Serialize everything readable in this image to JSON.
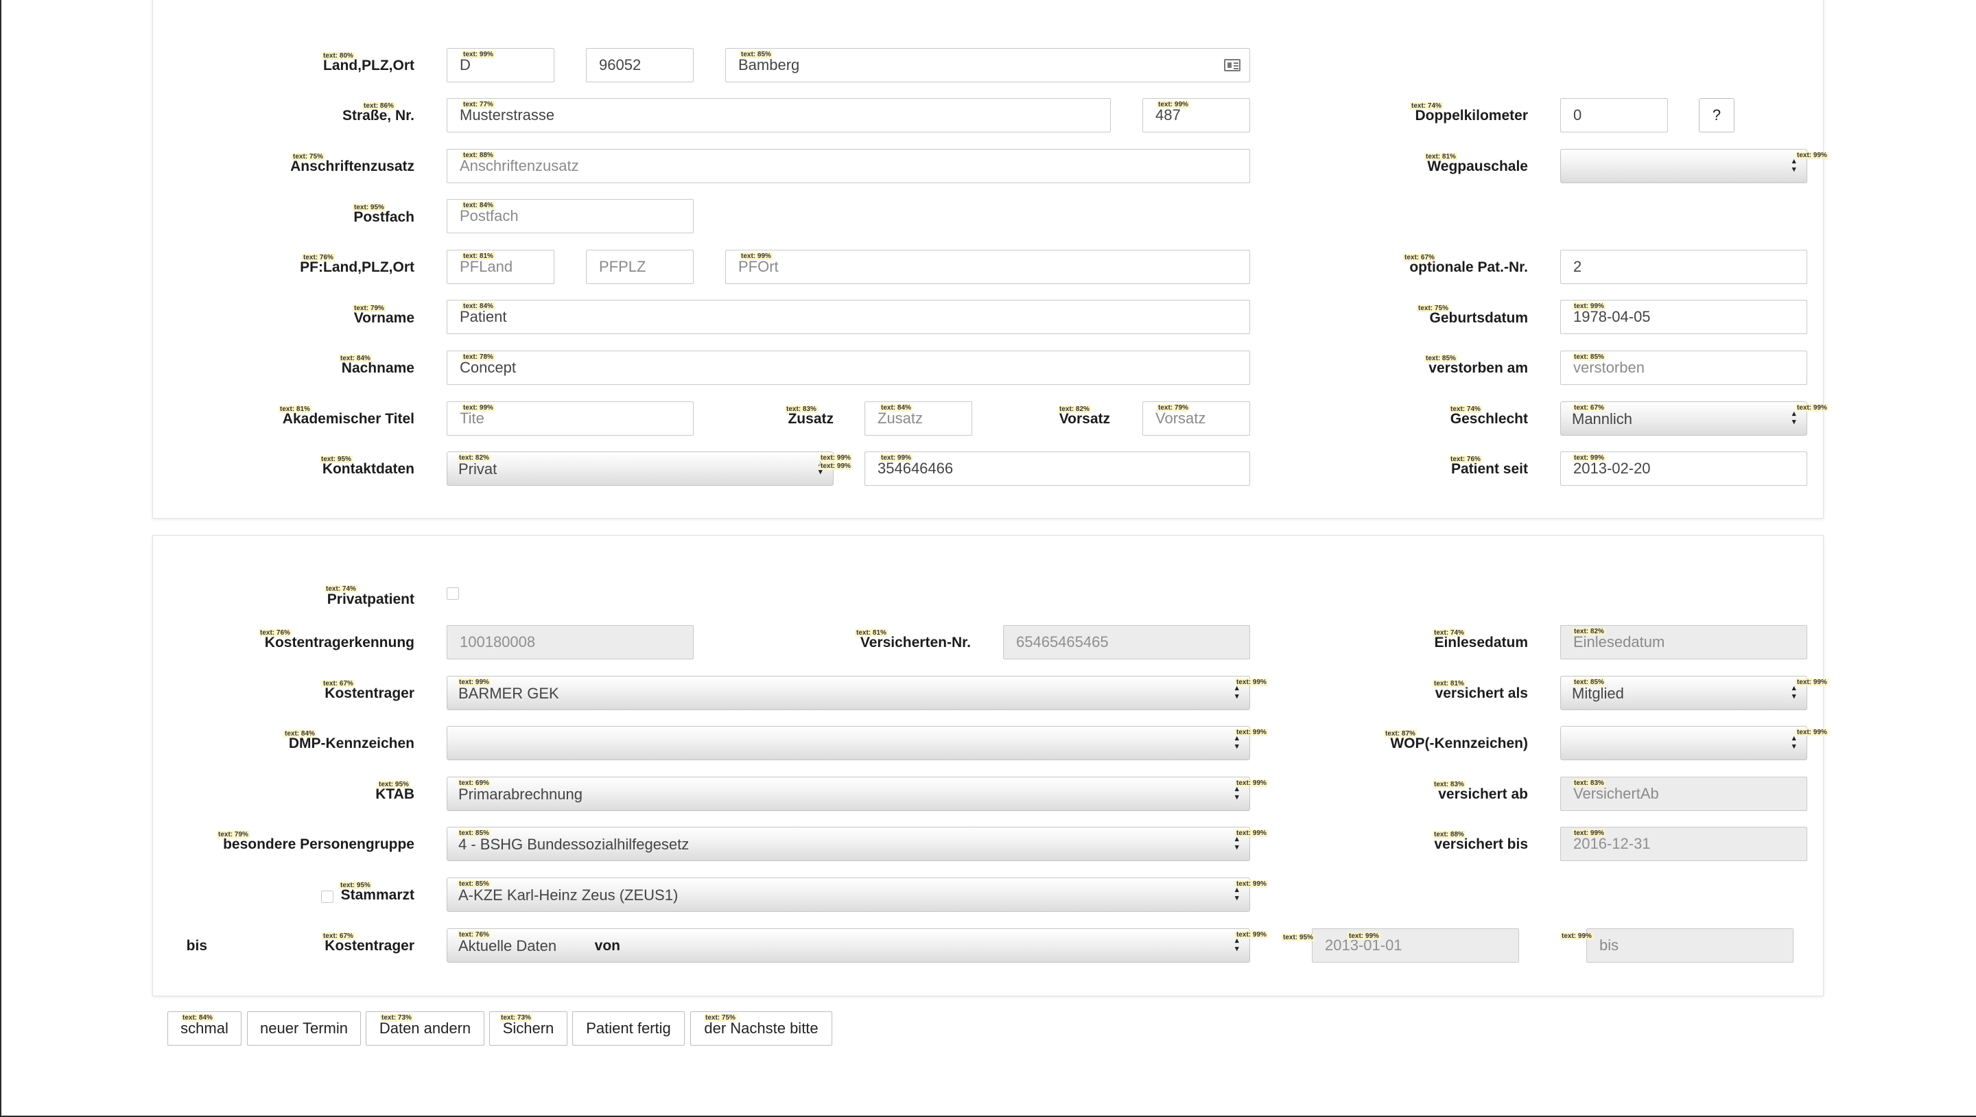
{
  "address": {
    "land_plz_ort_label": "Land,PLZ,Ort",
    "land_value": "D",
    "plz_value": "96052",
    "ort_value": "Bamberg",
    "strasse_label": "Straße, Nr.",
    "strasse_value": "Musterstrasse",
    "hausnr_value": "487",
    "anschriftzusatz_label": "Anschriftenzusatz",
    "anschriftzusatz_placeholder": "Anschriftenzusatz",
    "postfach_label": "Postfach",
    "postfach_placeholder": "Postfach",
    "pf_land_plz_ort_label": "PF:Land,PLZ,Ort",
    "pf_land_placeholder": "PFLand",
    "pf_plz_placeholder": "PFPLZ",
    "pf_ort_placeholder": "PFOrt"
  },
  "person": {
    "vorname_label": "Vorname",
    "vorname_value": "Patient",
    "nachname_label": "Nachname",
    "nachname_value": "Concept",
    "titel_label": "Akademischer Titel",
    "titel_placeholder": "Tite",
    "zusatz_label": "Zusatz",
    "zusatz_placeholder": "Zusatz",
    "vorsatz_label": "Vorsatz",
    "vorsatz_placeholder": "Vorsatz",
    "kontaktdaten_label": "Kontaktdaten",
    "kontaktdaten_type": "Privat",
    "kontaktdaten_value": "354646466"
  },
  "right": {
    "doppelkilometer_label": "Doppelkilometer",
    "doppelkilometer_value": "0",
    "help_label": "?",
    "wegpauschale_label": "Wegpauschale",
    "wegpauschale_value": "",
    "opt_patnr_label": "optionale Pat.-Nr.",
    "opt_patnr_value": "2",
    "geburtsdatum_label": "Geburtsdatum",
    "geburtsdatum_value": "1978-04-05",
    "verstorben_label": "verstorben am",
    "verstorben_placeholder": "verstorben",
    "geschlecht_label": "Geschlecht",
    "geschlecht_value": "Mannlich",
    "patient_seit_label": "Patient seit",
    "patient_seit_value": "2013-02-20"
  },
  "insurance": {
    "privatpatient_label": "Privatpatient",
    "kostentraegerkennung_label": "Kostentragerkennung",
    "kostentraegerkennung_value": "100180008",
    "versichertennr_label": "Versicherten-Nr.",
    "versichertennr_value": "65465465465",
    "einlesedatum_label": "Einlesedatum",
    "einlesedatum_placeholder": "Einlesedatum",
    "kostentraeger_label": "Kostentrager",
    "kostentraeger_value": "BARMER GEK",
    "versichert_als_label": "versichert als",
    "versichert_als_value": "Mitglied",
    "dmp_label": "DMP-Kennzeichen",
    "dmp_value": "",
    "wop_label": "WOP(-Kennzeichen)",
    "wop_value": "",
    "ktab_label": "KTAB",
    "ktab_value": "Primarabrechnung",
    "versichert_ab_label": "versichert ab",
    "versichert_ab_placeholder": "VersichertAb",
    "besondere_label": "besondere Personengruppe",
    "besondere_value": "4 - BSHG Bundessozialhilfegesetz",
    "versichert_bis_label": "versichert bis",
    "versichert_bis_value": "2016-12-31",
    "stammarzt_label": "Stammarzt",
    "stammarzt_value": "A-KZE Karl-Heinz Zeus (ZEUS1)",
    "kostentraeger2_label": "Kostentrager",
    "kostentraeger2_value": "Aktuelle Daten",
    "von_label": "von",
    "von_value": "2013-01-01",
    "bis_label": "bis",
    "bis_placeholder": "bis"
  },
  "buttons": {
    "schmal": "schmal",
    "neuer_termin": "neuer Termin",
    "daten_aendern": "Daten andern",
    "sichern": "Sichern",
    "patient_fertig": "Patient fertig",
    "der_naechste": "der Nachste bitte"
  },
  "tags": {
    "t80": "text: 80%",
    "t99": "text: 99%",
    "t85": "text: 85%",
    "t86": "text: 86%",
    "t77": "text: 77%",
    "t74": "text: 74%",
    "t75": "text: 75%",
    "t88": "text: 88%",
    "t81": "text: 81%",
    "t95": "text: 95%",
    "t84": "text: 84%",
    "t76": "text: 76%",
    "t67": "text: 67%",
    "t79": "text: 79%",
    "t78": "text: 78%",
    "t83": "text: 83%",
    "t82": "text: 82%",
    "t69": "text: 69%",
    "t87": "text: 87%",
    "t73": "text: 73%"
  }
}
